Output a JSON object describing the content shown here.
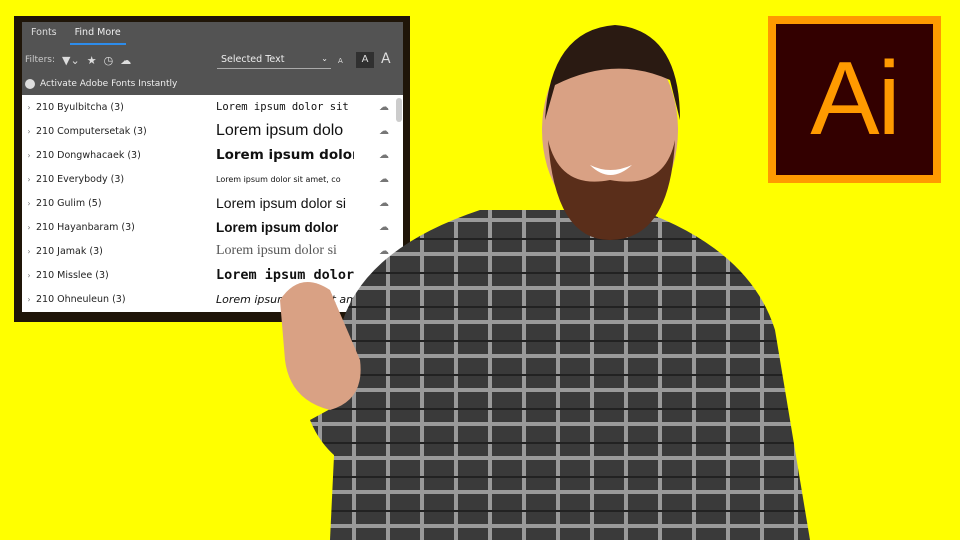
{
  "panel": {
    "tabs": [
      {
        "label": "Fonts",
        "active": false
      },
      {
        "label": "Find More",
        "active": true
      }
    ],
    "filters_label": "Filters:",
    "filter_icons": [
      "filter-icon",
      "star-icon",
      "clock-icon",
      "cloud-check-icon"
    ],
    "preview_select": "Selected Text",
    "size_buttons": [
      "A",
      "A",
      "A"
    ],
    "activate_label": "Activate Adobe Fonts Instantly",
    "fonts": [
      {
        "name": "210 Byulbitcha (3)",
        "preview": "Lorem ipsum dolor sit ame"
      },
      {
        "name": "210 Computersetak (3)",
        "preview": "Lorem ipsum dolo"
      },
      {
        "name": "210 Dongwhacaek (3)",
        "preview": "Lorem ipsum dolor"
      },
      {
        "name": "210 Everybody (3)",
        "preview": "Lorem ipsum dolor sit amet, co"
      },
      {
        "name": "210 Gulim (5)",
        "preview": "Lorem ipsum dolor si"
      },
      {
        "name": "210 Hayanbaram (3)",
        "preview": "Lorem ipsum dolor"
      },
      {
        "name": "210 Jamak (3)",
        "preview": "Lorem ipsum dolor si"
      },
      {
        "name": "210 Misslee (3)",
        "preview": "Lorem ipsum dolor"
      },
      {
        "name": "210 Ohneuleun (3)",
        "preview": "Lorem ipsum dolor sit am"
      }
    ]
  },
  "logo": {
    "text": "Ai",
    "bg": "#330000",
    "accent": "#FF9A00"
  },
  "colors": {
    "background": "#FFFF00",
    "panel": "#535353",
    "tab_underline": "#2d8ceb"
  }
}
